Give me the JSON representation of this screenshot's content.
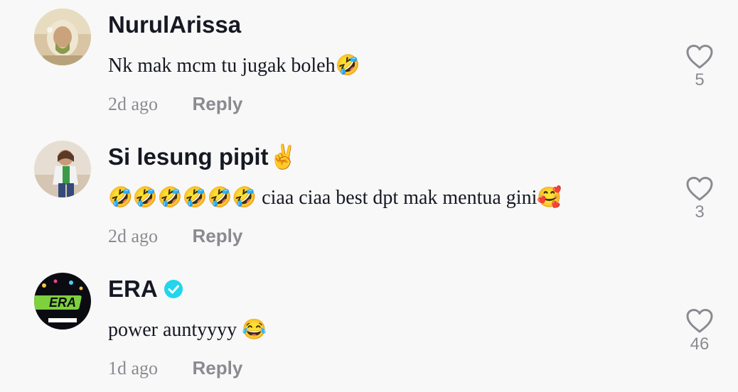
{
  "comments": [
    {
      "username": "NurulArissa",
      "text": "Nk mak mcm tu jugak boleh🤣",
      "time": "2d ago",
      "reply_label": "Reply",
      "likes": "5",
      "icons": [
        "rofl-emoji"
      ]
    },
    {
      "username": "Si lesung pipit✌️",
      "text": "🤣🤣🤣🤣🤣🤣 ciaa ciaa best dpt mak mentua gini🥰",
      "time": "2d ago",
      "reply_label": "Reply",
      "likes": "3",
      "icons": [
        "rofl-emoji",
        "victory-hand-emoji",
        "smiling-face-hearts-emoji"
      ]
    },
    {
      "username": "ERA",
      "verified": true,
      "text": "power auntyyyy 😂",
      "time": "1d ago",
      "reply_label": "Reply",
      "likes": "46",
      "icons": [
        "verified-badge-icon",
        "tears-of-joy-emoji"
      ]
    }
  ],
  "colors": {
    "background": "#f8f8f8",
    "username": "#161823",
    "muted": "#8a8b91",
    "verified": "#20d5ec"
  }
}
